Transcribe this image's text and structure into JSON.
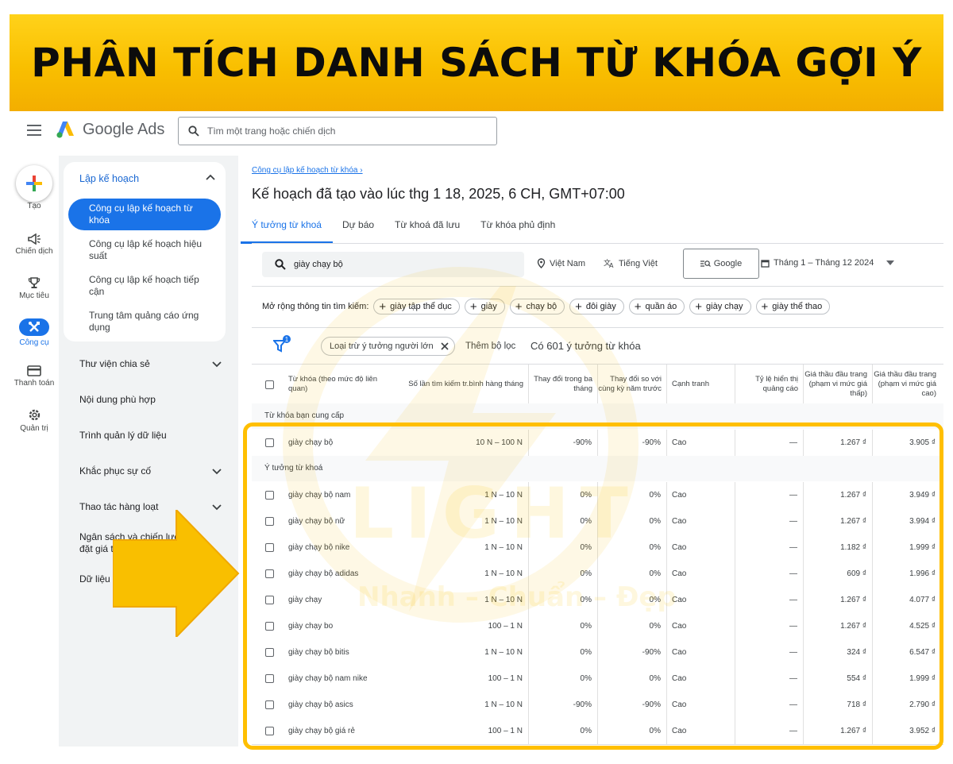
{
  "banner": {
    "title": "PHÂN TÍCH DANH SÁCH TỪ KHÓA GỢI Ý"
  },
  "app": {
    "product_name": "Google Ads",
    "search_placeholder": "Tìm một trang hoặc chiến dịch"
  },
  "rail": {
    "create": "Tạo",
    "campaigns": "Chiến dịch",
    "goals": "Mục tiêu",
    "tools": "Công cụ",
    "billing": "Thanh toán",
    "admin": "Quản trị"
  },
  "sidebar": {
    "section": "Lập kế hoạch",
    "active": "Công cụ lập kế hoạch từ khóa",
    "subs": [
      "Công cụ lập kế hoạch hiệu suất",
      "Công cụ lập kế hoạch tiếp cận",
      "Trung tâm quảng cáo ứng dụng"
    ],
    "items": [
      "Thư viện chia sẻ",
      "Nội dung phù hợp",
      "Trình quản lý dữ liệu",
      "Khắc phục sự cố",
      "Thao tác hàng loạt",
      "Ngân sách và chiến lược đặt giá thầu",
      "Dữ liệu doanh nghiệp"
    ]
  },
  "main": {
    "breadcrumb": "Công cụ lập kế hoạch từ khóa ›",
    "title": "Kế hoạch đã tạo vào lúc thg 1 18, 2025, 6 CH, GMT+07:00",
    "tabs": [
      "Ý tưởng từ khoá",
      "Dự báo",
      "Từ khoá đã lưu",
      "Từ khóa phủ định"
    ],
    "keyword_query": "giày chạy bộ",
    "location": "Việt Nam",
    "language": "Tiếng Việt",
    "network": "Google",
    "date_range": "Tháng 1 – Tháng 12 2024",
    "broaden_label": "Mở rộng thông tin tìm kiếm:",
    "broaden_chips": [
      "giày tập thể dục",
      "giày",
      "chạy bộ",
      "đôi giày",
      "quần áo",
      "giày chạy",
      "giày thể thao"
    ],
    "filter_badge": "1",
    "exclude_chip": "Loại trừ ý tưởng người lớn",
    "add_filter": "Thêm bộ lọc",
    "idea_count": "Có 601 ý tưởng từ khóa"
  },
  "table": {
    "headers": {
      "keyword": "Từ khóa (theo mức độ liên quan)",
      "searches": "Số lần tìm kiếm tr.bình hàng tháng",
      "change3m": "Thay đổi trong ba tháng",
      "changeyoy": "Thay đổi so với cùng kỳ năm trước",
      "competition": "Cạnh tranh",
      "impression": "Tỷ lệ hiển thị quảng cáo",
      "bid_low": "Giá thầu đầu trang (phạm vi mức giá thấp)",
      "bid_high": "Giá thầu đầu trang (phạm vi mức giá cao)"
    },
    "group_provided": "Từ khóa bạn cung cấp",
    "group_ideas": "Ý tưởng từ khoá",
    "provided_rows": [
      {
        "keyword": "giày chạy bộ",
        "searches": "10 N – 100 N",
        "change3m": "-90%",
        "changeyoy": "-90%",
        "competition": "Cao",
        "impression": "—",
        "bid_low": "1.267 ₫",
        "bid_high": "3.905 ₫"
      }
    ],
    "idea_rows": [
      {
        "keyword": "giày chạy bộ nam",
        "searches": "1 N – 10 N",
        "change3m": "0%",
        "changeyoy": "0%",
        "competition": "Cao",
        "impression": "—",
        "bid_low": "1.267 ₫",
        "bid_high": "3.949 ₫"
      },
      {
        "keyword": "giày chạy bộ nữ",
        "searches": "1 N – 10 N",
        "change3m": "0%",
        "changeyoy": "0%",
        "competition": "Cao",
        "impression": "—",
        "bid_low": "1.267 ₫",
        "bid_high": "3.994 ₫"
      },
      {
        "keyword": "giày chạy bộ nike",
        "searches": "1 N – 10 N",
        "change3m": "0%",
        "changeyoy": "0%",
        "competition": "Cao",
        "impression": "—",
        "bid_low": "1.182 ₫",
        "bid_high": "1.999 ₫"
      },
      {
        "keyword": "giày chạy bộ adidas",
        "searches": "1 N – 10 N",
        "change3m": "0%",
        "changeyoy": "0%",
        "competition": "Cao",
        "impression": "—",
        "bid_low": "609 ₫",
        "bid_high": "1.996 ₫"
      },
      {
        "keyword": "giày chạy",
        "searches": "1 N – 10 N",
        "change3m": "0%",
        "changeyoy": "0%",
        "competition": "Cao",
        "impression": "—",
        "bid_low": "1.267 ₫",
        "bid_high": "4.077 ₫"
      },
      {
        "keyword": "giày chạy bo",
        "searches": "100 – 1 N",
        "change3m": "0%",
        "changeyoy": "0%",
        "competition": "Cao",
        "impression": "—",
        "bid_low": "1.267 ₫",
        "bid_high": "4.525 ₫"
      },
      {
        "keyword": "giày chạy bộ bitis",
        "searches": "1 N – 10 N",
        "change3m": "0%",
        "changeyoy": "-90%",
        "competition": "Cao",
        "impression": "—",
        "bid_low": "324 ₫",
        "bid_high": "6.547 ₫"
      },
      {
        "keyword": "giày chạy bộ nam nike",
        "searches": "100 – 1 N",
        "change3m": "0%",
        "changeyoy": "0%",
        "competition": "Cao",
        "impression": "—",
        "bid_low": "554 ₫",
        "bid_high": "1.999 ₫"
      },
      {
        "keyword": "giày chạy bộ asics",
        "searches": "1 N – 10 N",
        "change3m": "-90%",
        "changeyoy": "-90%",
        "competition": "Cao",
        "impression": "—",
        "bid_low": "718 ₫",
        "bid_high": "2.790 ₫"
      },
      {
        "keyword": "giày chạy bộ giá rẻ",
        "searches": "100 – 1 N",
        "change3m": "0%",
        "changeyoy": "0%",
        "competition": "Cao",
        "impression": "—",
        "bid_low": "1.267 ₫",
        "bid_high": "3.952 ₫"
      }
    ]
  },
  "watermark": {
    "brand": "LIGHT",
    "tagline": "Nhanh – Chuẩn – Đẹp"
  },
  "colors": {
    "banner": "#f9bf00",
    "accent": "#1a73e8",
    "highlight": "#ffbf00"
  }
}
